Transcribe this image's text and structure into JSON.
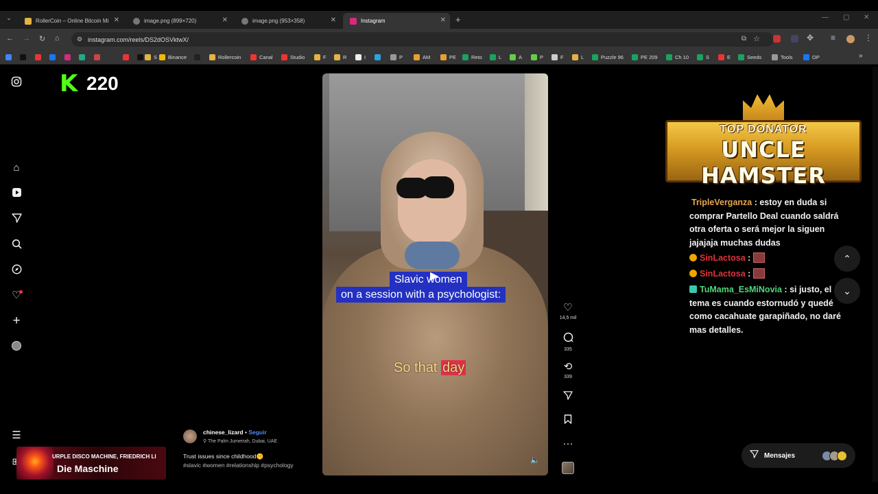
{
  "browser": {
    "tabs": [
      {
        "title": "RollerCoin – Online Bitcoin Mi",
        "fav": "#e3b343"
      },
      {
        "title": "image.png (899×720)",
        "fav": "#777"
      },
      {
        "title": "image.png (953×358)",
        "fav": "#777"
      },
      {
        "title": "Instagram",
        "fav": "#d6297f"
      }
    ],
    "new_tab": "+",
    "url": "instagram.com/reels/DS2dOSVktwX/",
    "bookmarks": [
      {
        "label": "",
        "color": "#4285f4"
      },
      {
        "label": "",
        "color": "#111"
      },
      {
        "label": "",
        "color": "#e33"
      },
      {
        "label": "",
        "color": "#1877f2"
      },
      {
        "label": "",
        "color": "#d6297f"
      },
      {
        "label": "",
        "color": "#2a8"
      },
      {
        "label": "",
        "color": "#c44"
      },
      {
        "label": "",
        "color": "#e33"
      },
      {
        "label": "",
        "color": "#111"
      },
      {
        "label": "S",
        "color": "#e3b343"
      },
      {
        "label": "Binance",
        "color": "#f0b90b"
      },
      {
        "label": "",
        "color": "#222"
      },
      {
        "label": "Rollercoin",
        "color": "#e3b343"
      },
      {
        "label": "Canal",
        "color": "#e33"
      },
      {
        "label": "Studio",
        "color": "#e33"
      },
      {
        "label": "F",
        "color": "#e3b343"
      },
      {
        "label": "R",
        "color": "#e3b343"
      },
      {
        "label": "I",
        "color": "#eee"
      },
      {
        "label": "",
        "color": "#2aa2e0"
      },
      {
        "label": "P",
        "color": "#999"
      },
      {
        "label": "AM",
        "color": "#e8a030"
      },
      {
        "label": "PE",
        "color": "#e8a030"
      },
      {
        "label": "Reto",
        "color": "#1aa260"
      },
      {
        "label": "L",
        "color": "#1aa260"
      },
      {
        "label": "A",
        "color": "#6c4"
      },
      {
        "label": "P",
        "color": "#6c4"
      },
      {
        "label": "F",
        "color": "#ccc"
      },
      {
        "label": "L",
        "color": "#e3b343"
      },
      {
        "label": "Puzzle 96",
        "color": "#1aa260"
      },
      {
        "label": "PE 209",
        "color": "#1aa260"
      },
      {
        "label": "Ch 10",
        "color": "#1aa260"
      },
      {
        "label": "S",
        "color": "#1aa260"
      },
      {
        "label": "E",
        "color": "#e33"
      },
      {
        "label": "Seeds",
        "color": "#1aa260"
      },
      {
        "label": "Tools",
        "color": "#999"
      },
      {
        "label": "OP",
        "color": "#1877f2"
      }
    ]
  },
  "stream_overlay": {
    "kick_count": "220",
    "kick_logo": "K",
    "banner_line1": "TOP DONATOR",
    "banner_line2": "UNCLE HAMSTER",
    "music_artist": "URPLE DISCO MACHINE, FRIEDRICH LI",
    "music_title": "Die Maschine"
  },
  "reel": {
    "caption_line1": "Slavic women",
    "caption_line2": "on a session with a psychologist:",
    "subtitle_a": "So that",
    "subtitle_b": "day",
    "author": "chinese_lizard",
    "follow": "Seguir",
    "separator": "•",
    "location": "The Palm Jumeirah, Dubai, UAE",
    "description": "Trust issues since childhood🤫",
    "hashtags": "#slavic #women #relationship #psychology",
    "likes": "14,5 mil",
    "comments": "335",
    "reposts": "339"
  },
  "chat": [
    {
      "user": "TripleVerganza",
      "sep": " : ",
      "text": "estoy en duda si comprar Partello Deal cuando saldrá otra oferta o será mejor la siguen jajajaja muchas dudas",
      "color": "#e9a64a"
    },
    {
      "user": "SinLactosa",
      "sep": " : ",
      "text": "",
      "color": "#e0333a"
    },
    {
      "user": "SinLactosa",
      "sep": " : ",
      "text": "",
      "color": "#e0333a"
    },
    {
      "user": "TuMama_EsMiNovia",
      "sep": " : ",
      "text": "si justo, el tema es cuando estornudó y quedé como cacahuate garapiñado, no daré mas detalles.",
      "color": "#4fd67a"
    }
  ],
  "messages_label": "Mensajes"
}
